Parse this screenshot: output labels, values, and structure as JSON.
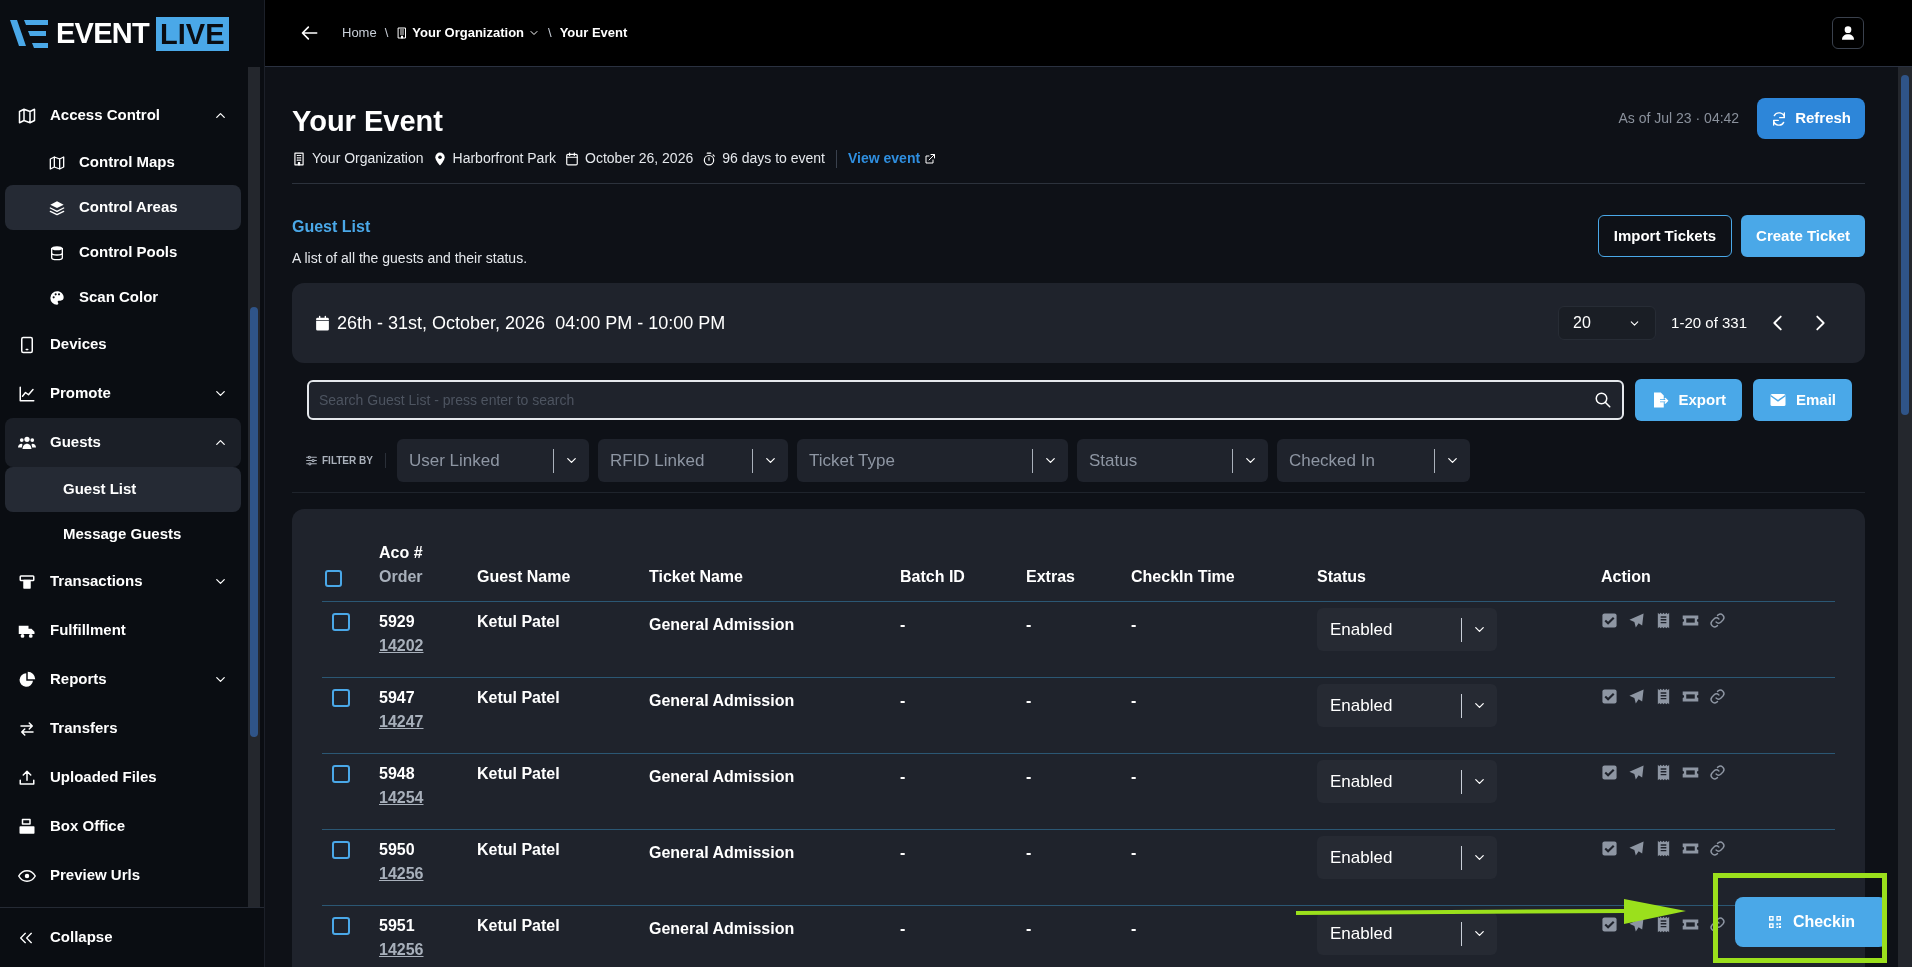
{
  "logo": {
    "word": "EVENT",
    "badge": "LIVE"
  },
  "sidebar": {
    "items": [
      {
        "label": "Access Control",
        "kind": "group",
        "expanded": true,
        "selected": false,
        "children": [
          {
            "label": "Control Maps",
            "selected": false
          },
          {
            "label": "Control Areas",
            "selected": true
          },
          {
            "label": "Control Pools",
            "selected": false
          },
          {
            "label": "Scan Color",
            "selected": false
          }
        ]
      },
      {
        "label": "Devices",
        "kind": "link",
        "selected": false
      },
      {
        "label": "Promote",
        "kind": "group",
        "expanded": false,
        "selected": false
      },
      {
        "label": "Guests",
        "kind": "group",
        "expanded": true,
        "selected": true,
        "children": [
          {
            "label": "Guest List",
            "selected": true
          },
          {
            "label": "Message Guests",
            "selected": false
          }
        ]
      },
      {
        "label": "Transactions",
        "kind": "group",
        "expanded": false,
        "selected": false
      },
      {
        "label": "Fulfillment",
        "kind": "link",
        "selected": false
      },
      {
        "label": "Reports",
        "kind": "group",
        "expanded": false,
        "selected": false
      },
      {
        "label": "Transfers",
        "kind": "link",
        "selected": false
      },
      {
        "label": "Uploaded Files",
        "kind": "link",
        "selected": false
      },
      {
        "label": "Box Office",
        "kind": "link",
        "selected": false
      },
      {
        "label": "Preview Urls",
        "kind": "link",
        "selected": false
      }
    ],
    "collapse": "Collapse"
  },
  "breadcrumb": [
    {
      "kind": "link",
      "label": "Home"
    },
    {
      "kind": "separator",
      "label": "\\"
    },
    {
      "kind": "dropdown",
      "label": "Your Organization"
    },
    {
      "kind": "separator",
      "label": "\\"
    },
    {
      "kind": "current",
      "label": "Your Event"
    }
  ],
  "event": {
    "title": "Your Event",
    "updated": "As of Jul 23 · 04:42",
    "refresh": "Refresh",
    "meta": [
      {
        "kind": "organization",
        "label": "Your Organization"
      },
      {
        "kind": "venue",
        "label": "Harborfront Park"
      },
      {
        "kind": "date",
        "label": "October 26, 2026"
      },
      {
        "kind": "countdown",
        "label": "96 days to event"
      },
      {
        "kind": "link",
        "label": "View event"
      }
    ]
  },
  "guest_list": {
    "title": "Guest List",
    "description": "A list of all the guests and their status.",
    "buttons": [
      "Import Tickets",
      "Create Ticket"
    ],
    "date_range": "26th - 31st, October, 2026  04:00 PM - 10:00 PM",
    "page_size": "20",
    "range": "1-20 of 331",
    "search": {
      "placeholder": "Search Guest List - press enter to search"
    },
    "actions": [
      "Export",
      "Email"
    ],
    "filter_label": "FILTER BY",
    "filters": [
      "User Linked",
      "RFID Linked",
      "Ticket Type",
      "Status",
      "Checked In"
    ]
  },
  "table": {
    "select_all": {
      "checked": false
    },
    "columns": [
      {
        "top": "Aco #",
        "bottom": "Order"
      },
      {
        "bottom": "Guest Name"
      },
      {
        "bottom": "Ticket Name"
      },
      {
        "bottom": "Batch ID"
      },
      {
        "bottom": "Extras"
      },
      {
        "bottom": "CheckIn Time"
      },
      {
        "bottom": "Status"
      },
      {
        "bottom": "Action"
      }
    ],
    "rows": [
      {
        "checked": false,
        "aco": "5929",
        "order": "14202",
        "guest": "Ketul Patel",
        "ticket": "General Admission",
        "batch": "-",
        "extras": "-",
        "checkin_time": "-",
        "status": "Enabled"
      },
      {
        "checked": false,
        "aco": "5947",
        "order": "14247",
        "guest": "Ketul Patel",
        "ticket": "General Admission",
        "batch": "-",
        "extras": "-",
        "checkin_time": "-",
        "status": "Enabled"
      },
      {
        "checked": false,
        "aco": "5948",
        "order": "14254",
        "guest": "Ketul Patel",
        "ticket": "General Admission",
        "batch": "-",
        "extras": "-",
        "checkin_time": "-",
        "status": "Enabled"
      },
      {
        "checked": false,
        "aco": "5950",
        "order": "14256",
        "guest": "Ketul Patel",
        "ticket": "General Admission",
        "batch": "-",
        "extras": "-",
        "checkin_time": "-",
        "status": "Enabled"
      },
      {
        "checked": false,
        "aco": "5951",
        "order": "14256",
        "guest": "Ketul Patel",
        "ticket": "General Admission",
        "batch": "-",
        "extras": "-",
        "checkin_time": "-",
        "status": "Enabled"
      }
    ]
  },
  "checkin_button": "Checkin"
}
